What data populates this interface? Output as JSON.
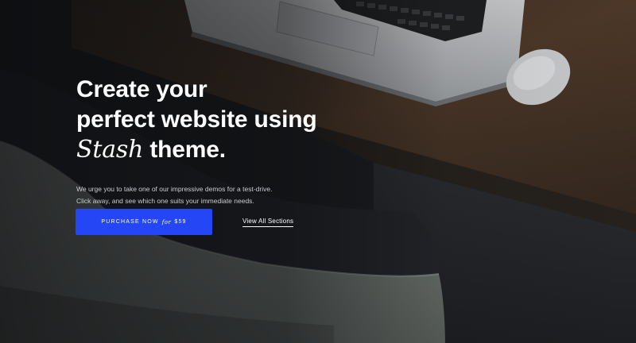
{
  "hero": {
    "headline_line1": "Create your",
    "headline_line2": "perfect website using",
    "headline_brand": "Stash",
    "headline_tail": " theme.",
    "subtext_line1": "We urge you to take one of our impressive demos for a test-drive.",
    "subtext_line2": "Click away, and see which one suits your immediate needs."
  },
  "actions": {
    "purchase_label": "PURCHASE NOW",
    "purchase_for": "for",
    "purchase_price": "$59",
    "view_sections_label": "View All Sections"
  },
  "colors": {
    "accent": "#2446f5",
    "background": "#1b1d21",
    "text": "#ffffff"
  }
}
